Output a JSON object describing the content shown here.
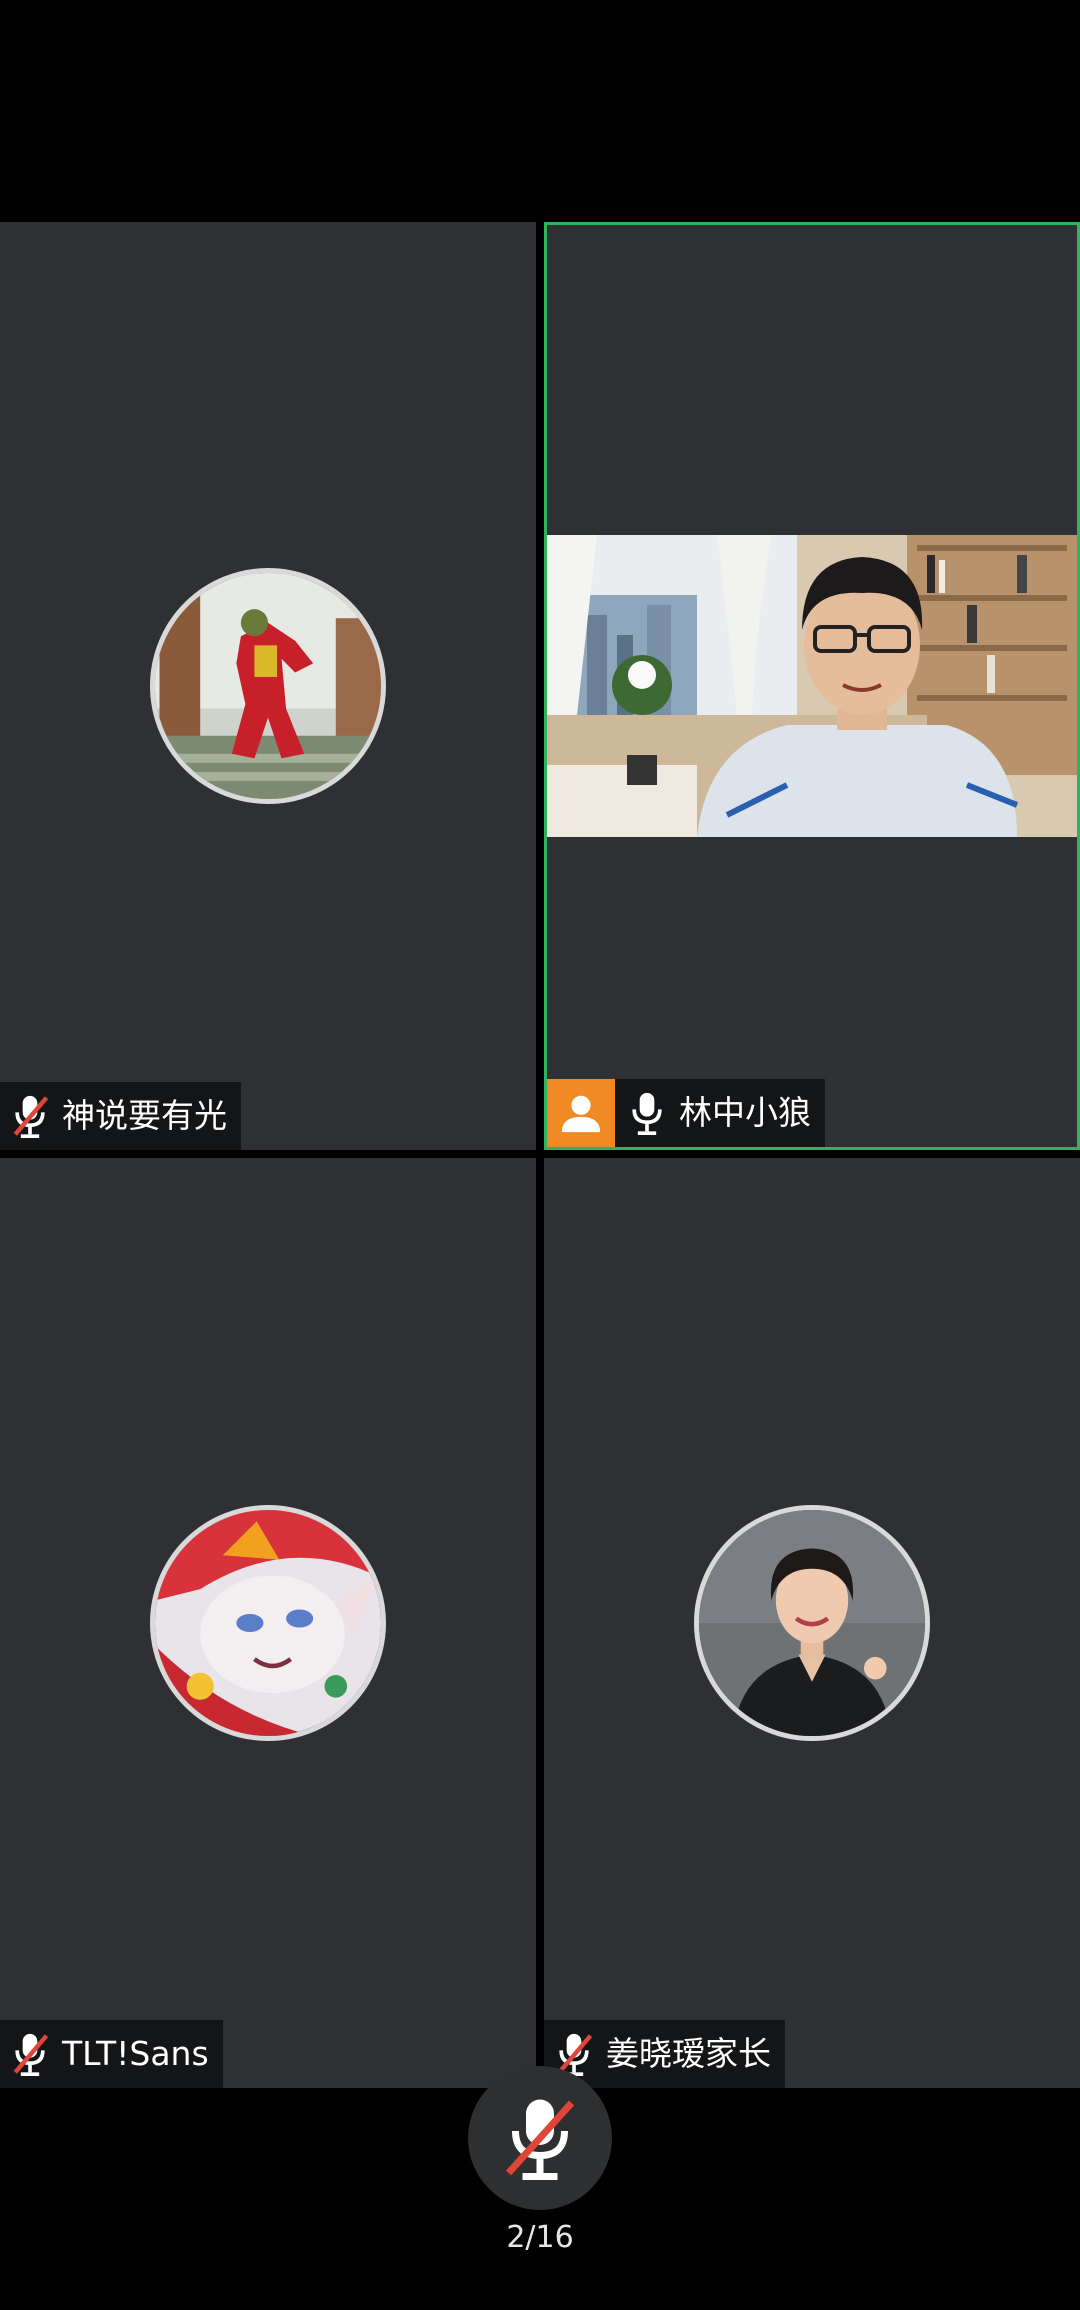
{
  "participants": [
    {
      "name": "神说要有光",
      "mic": "muted",
      "display": "avatar",
      "avatar_icon": "joker-avatar"
    },
    {
      "name": "林中小狼",
      "mic": "on",
      "display": "video",
      "is_host": true,
      "active_speaker": true,
      "avatar_icon": "host-person-icon"
    },
    {
      "name": "TLT!Sans",
      "mic": "muted",
      "display": "avatar",
      "avatar_icon": "cartoon-creature-avatar"
    },
    {
      "name": "姜晓瑷家长",
      "mic": "muted",
      "display": "avatar",
      "avatar_icon": "woman-portrait-avatar"
    }
  ],
  "controls": {
    "mic_button_state": "muted",
    "page_indicator": "2/16"
  },
  "colors": {
    "active_speaker_border": "#2fb35b",
    "host_badge": "#f08a24",
    "tile_background": "#2e3033",
    "muted_slash": "#e0453a"
  }
}
